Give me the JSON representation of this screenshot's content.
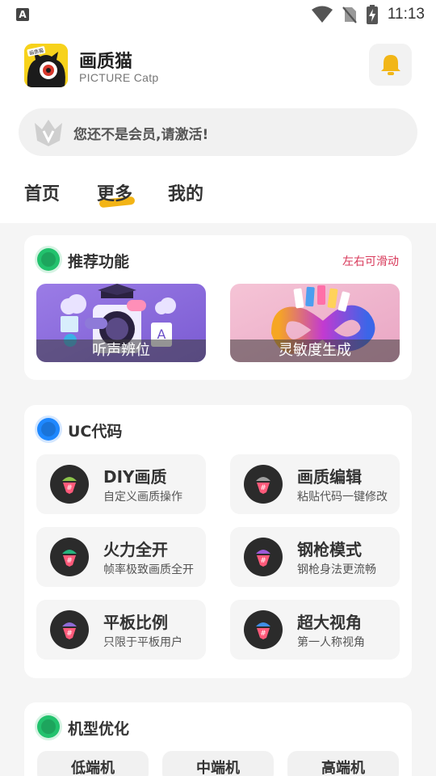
{
  "status_bar": {
    "time": "11:13",
    "left_icon_letter": "A"
  },
  "app": {
    "name": "画质猫",
    "subtitle": "PICTURE Catp",
    "logo_text": "画质猫"
  },
  "vip_bar": {
    "text": "您还不是会员,请激活!"
  },
  "tabs": [
    {
      "label": "首页"
    },
    {
      "label": "更多",
      "active": true
    },
    {
      "label": "我的"
    }
  ],
  "recommend": {
    "title": "推荐功能",
    "hint": "左右可滑动",
    "dot_color": "#22c26d",
    "banners": [
      {
        "label": "听声辨位"
      },
      {
        "label": "灵敏度生成"
      }
    ]
  },
  "uc": {
    "title": "UC代码",
    "dot_color": "#1e88ff",
    "items": [
      {
        "title": "DIY画质",
        "desc": "自定义画质操作",
        "icon_color": "#8bc34a"
      },
      {
        "title": "画质编辑",
        "desc": "粘贴代码一键修改",
        "icon_color": "#9e9e9e"
      },
      {
        "title": "火力全开",
        "desc": "帧率极致画质全开",
        "icon_color": "#26b47e"
      },
      {
        "title": "钢枪模式",
        "desc": "钢枪身法更流畅",
        "icon_color": "#9c5ad8"
      },
      {
        "title": "平板比例",
        "desc": "只限于平板用户",
        "icon_color": "#8e6bd6"
      },
      {
        "title": "超大视角",
        "desc": "第一人称视角",
        "icon_color": "#3f8fe6"
      }
    ]
  },
  "model": {
    "title": "机型优化",
    "dot_color": "#22c26d",
    "options": [
      {
        "label": "低端机"
      },
      {
        "label": "中端机"
      },
      {
        "label": "高端机"
      }
    ]
  },
  "colors": {
    "accent_yellow": "#f3b415",
    "hint_red": "#d83a5b",
    "card_bg": "#ffffff",
    "page_bg": "#f5f5f5"
  }
}
